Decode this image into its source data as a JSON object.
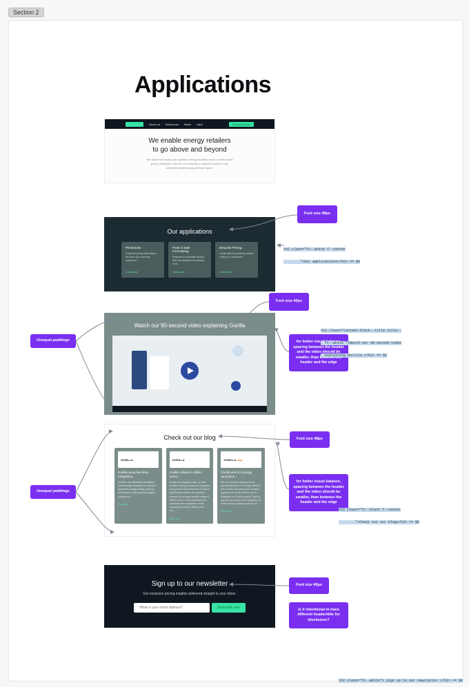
{
  "section_tag": "Section 2",
  "page_title": "Applications",
  "hero": {
    "nav": {
      "items": [
        "About us",
        "Resources",
        "News",
        "Labs"
      ],
      "cta": "Request demo"
    },
    "heading": "We enable energy retailers to go above and beyond",
    "sub": "We deliver the tools and expertise energy retailers need to make smart pricing decisions. We are on a mission to build the world's most advanced retail energy pricing engine."
  },
  "apps": {
    "heading": "Our applications",
    "cards": [
      {
        "t": "Pricebooks",
        "d": "Generate pricing that reflects the true cost of serving customers.",
        "l": "Learn more"
      },
      {
        "t": "Point of Sale Forecasting",
        "d": "Respond to proposals quickly with risk-weighted forecasting tools.",
        "l": "Learn more"
      },
      {
        "t": "Bespoke Pricing",
        "d": "Create tailored products without relying on consultants.",
        "l": "Learn more"
      }
    ]
  },
  "video": {
    "heading": "Watch our 90-second video explaining Gorilla"
  },
  "blog": {
    "heading": "Check out our blog",
    "cards": [
      {
        "logo": "GORILLA",
        "plus": "",
        "t": "Gorilla Launches New Integration...",
        "d": "Gorilla's new Bluefield calculation methodology changes the way you approach energy pricing, helping businesses create granular digital solutions to...",
        "l": "Read this"
      },
      {
        "logo": "GORILLA",
        "plus": "",
        "t": "Gorilla collects 6 million euros...",
        "d": "Gorilla, the Belgian scale-up that enables energy companies to gather and process vast amounts of data to significantly shorten the quoting process for energy markets raises 6 million euros. This investment will accelerate the expansion of the company's product offering and the...",
        "l": "Read this"
      },
      {
        "logo": "GORILLA",
        "plus": "nrg",
        "t": "Gorilla and YU Energy announce...",
        "d": "We are proud to announce our partnership with YU Energy. Behind the scenes, we have been working together for a few months now to integrate our Gorilla engine. Safe to say we are proud of the progress we made within a speedy delivery of...",
        "l": "Read this"
      }
    ]
  },
  "news": {
    "heading": "Sign up to our newsletter",
    "sub": "Get exclusive pricing insights delivered straight to your inbox.",
    "placeholder": "What is your email address?",
    "cta": "Subscribe now"
  },
  "annotations": {
    "fs48a": "Font size 48px",
    "fs40a": "Font size 40px",
    "fs48b": "Font size 48px",
    "fs40b": "Font size 40px",
    "unequal1": "Unequal paddings",
    "unequal2": "Unequal paddings",
    "balance1": "for better visual balance, spacing between the header and the video should be smaller, than between the header and the edge",
    "balance2": "for better visual balance, spacing between the header and the video should be smaller, than between the header and the edge",
    "q": "Is it intentional to have different header/title for blocksizes?",
    "code1": "<h2 class=\"fc--white f--center\n        \">Our applications</h2> == $0",
    "code2": "<h2 class=\"content-block--title title--\n  fc--white \">Watch our 90-second video\n  explaining Gorilla </h2> == $0",
    "code3": "<h2 class=\"fc--black f--center\n        \">Check out our blog</h2> == $0",
    "code4": "<h2 class=\"fc--white\"> Sign up to our newsletter </h2> == $0"
  }
}
